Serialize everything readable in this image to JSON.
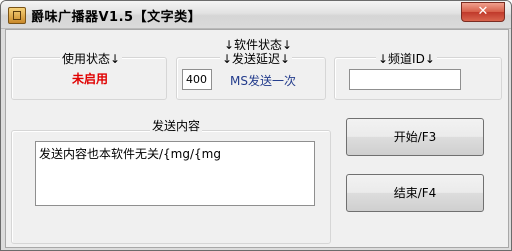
{
  "window": {
    "title": "爵味广播器V1.5【文字类】",
    "close_label": "✕"
  },
  "software_status": {
    "label": "↓软件状态↓"
  },
  "usage_status": {
    "label": "使用状态↓",
    "value": "未启用"
  },
  "send_delay": {
    "label": "↓发送延迟↓",
    "value": "400",
    "unit": "MS发送一次"
  },
  "channel_id": {
    "label": "↓频道ID↓",
    "value": ""
  },
  "send_content": {
    "label": "发送内容",
    "value": "发送内容也本软件无关/{mg/{mg"
  },
  "buttons": {
    "start": "开始/F3",
    "end": "结束/F4"
  }
}
